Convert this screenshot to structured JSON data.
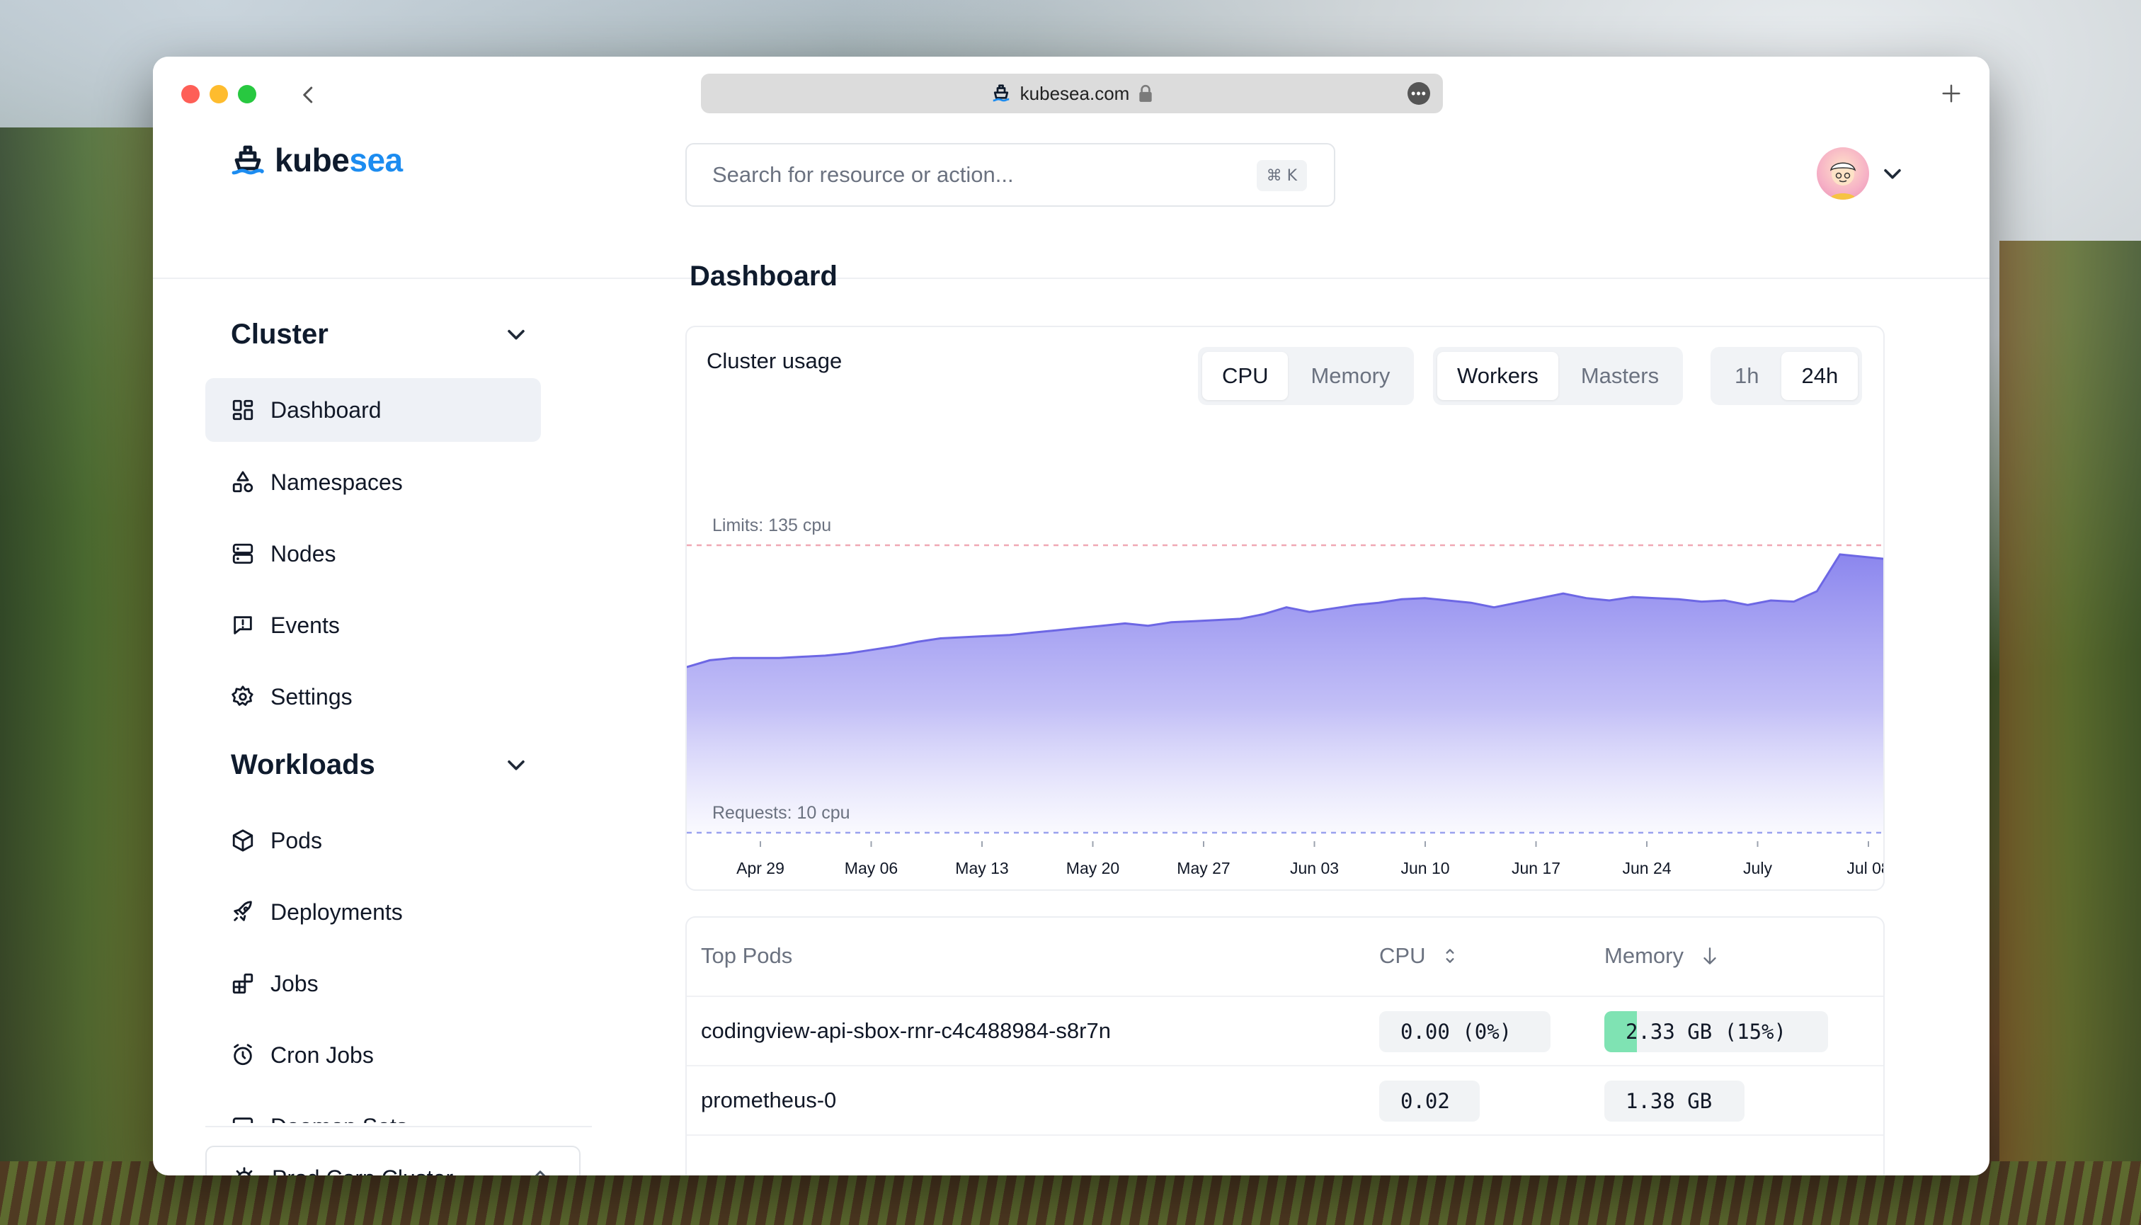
{
  "browser": {
    "url": "kubesea.com"
  },
  "header": {
    "logo_part1": "kube",
    "logo_part2": "sea",
    "search_placeholder": "Search for resource or action...",
    "search_shortcut": "⌘ K"
  },
  "sidebar": {
    "sections": [
      {
        "title": "Cluster",
        "items": [
          {
            "label": "Dashboard",
            "icon": "dashboard-icon",
            "active": true
          },
          {
            "label": "Namespaces",
            "icon": "shapes-icon"
          },
          {
            "label": "Nodes",
            "icon": "server-icon"
          },
          {
            "label": "Events",
            "icon": "message-alert-icon"
          },
          {
            "label": "Settings",
            "icon": "gear-icon"
          }
        ]
      },
      {
        "title": "Workloads",
        "items": [
          {
            "label": "Pods",
            "icon": "cube-icon"
          },
          {
            "label": "Deployments",
            "icon": "rocket-icon"
          },
          {
            "label": "Jobs",
            "icon": "blocks-icon"
          },
          {
            "label": "Cron Jobs",
            "icon": "alarm-clock-icon"
          },
          {
            "label": "Daemon Sets",
            "icon": "monitor-icon"
          }
        ]
      }
    ],
    "cluster_selector": "Prod Corp Cluster"
  },
  "main": {
    "title": "Dashboard",
    "usage_card": {
      "title": "Cluster usage",
      "metric_toggle": [
        "CPU",
        "Memory"
      ],
      "metric_selected": "CPU",
      "role_toggle": [
        "Workers",
        "Masters"
      ],
      "role_selected": "Workers",
      "range_toggle": [
        "1h",
        "24h"
      ],
      "range_selected": "24h"
    },
    "top_pods": {
      "headers": {
        "name": "Top Pods",
        "cpu": "CPU",
        "memory": "Memory"
      },
      "rows": [
        {
          "name": "codingview-api-sbox-rnr-c4c488984-s8r7n",
          "cpu": "0.00 (0%)",
          "memory": "2.33 GB (15%)",
          "memory_pct": 15
        },
        {
          "name": "prometheus-0",
          "cpu": "0.02",
          "memory": "1.38 GB",
          "memory_pct": 0
        }
      ]
    }
  },
  "colors": {
    "accent": "#1c8cf0",
    "area_top": "#8b86ee",
    "area_line": "#6d67e4",
    "limit_line": "#f0a8b4",
    "request_line": "#9aa2ee",
    "memory_fill": "#7fe3b3"
  },
  "chart_data": {
    "type": "area",
    "title": "",
    "limit_label": "Limits: 135 cpu",
    "request_label": "Requests: 10 cpu",
    "limit_value": 135,
    "request_value": 10,
    "ylim": [
      10,
      135
    ],
    "x_ticks": [
      "Apr 29",
      "May 06",
      "May 13",
      "May 20",
      "May 27",
      "Jun 03",
      "Jun 10",
      "Jun 17",
      "Jun 24",
      "July",
      "Jul 08"
    ],
    "series": [
      {
        "values": [
          [
            0,
            82
          ],
          [
            2,
            85
          ],
          [
            4,
            86
          ],
          [
            6,
            86
          ],
          [
            8,
            86
          ],
          [
            10,
            86.5
          ],
          [
            12,
            87
          ],
          [
            14,
            88
          ],
          [
            16,
            89.5
          ],
          [
            18,
            91
          ],
          [
            20,
            93
          ],
          [
            22,
            94.5
          ],
          [
            24,
            95
          ],
          [
            26,
            95.5
          ],
          [
            28,
            96
          ],
          [
            30,
            97
          ],
          [
            32,
            98
          ],
          [
            34,
            99
          ],
          [
            36,
            100
          ],
          [
            38,
            101
          ],
          [
            40,
            100
          ],
          [
            42,
            101.5
          ],
          [
            44,
            102
          ],
          [
            46,
            102.5
          ],
          [
            48,
            103
          ],
          [
            50,
            105
          ],
          [
            52,
            108
          ],
          [
            54,
            106
          ],
          [
            56,
            107.5
          ],
          [
            58,
            109
          ],
          [
            60,
            110
          ],
          [
            62,
            111.5
          ],
          [
            64,
            112
          ],
          [
            66,
            111
          ],
          [
            68,
            110
          ],
          [
            70,
            108
          ],
          [
            72,
            110
          ],
          [
            74,
            112
          ],
          [
            76,
            114
          ],
          [
            78,
            112
          ],
          [
            80,
            111
          ],
          [
            82,
            112.5
          ],
          [
            84,
            112
          ],
          [
            86,
            111.5
          ],
          [
            88,
            110.5
          ],
          [
            90,
            111
          ],
          [
            92,
            109
          ],
          [
            94,
            111
          ],
          [
            96,
            110.5
          ],
          [
            98,
            115
          ],
          [
            100,
            131
          ],
          [
            102,
            130
          ],
          [
            104,
            129
          ]
        ]
      }
    ]
  }
}
